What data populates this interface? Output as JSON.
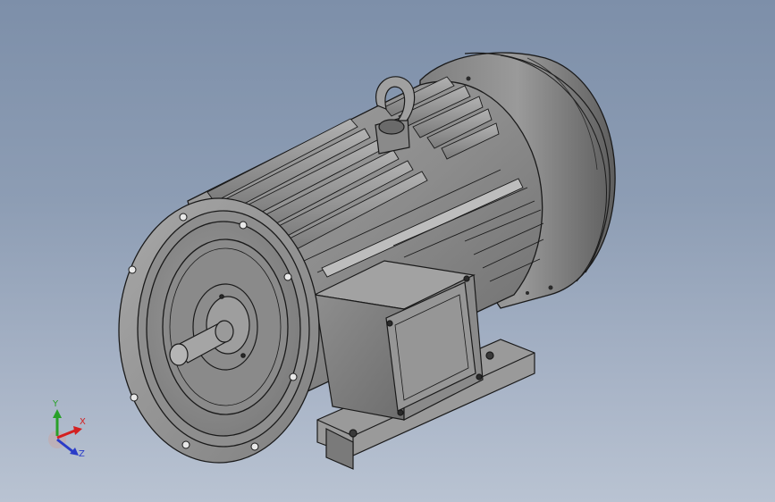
{
  "triad": {
    "x_label": "X",
    "y_label": "Y",
    "z_label": "Z",
    "x_color": "#d42020",
    "y_color": "#28a028",
    "z_color": "#2a3cc8"
  },
  "colors": {
    "background_top": "#7d8fa9",
    "background_bottom": "#b9c3d2",
    "body_metal": "#8a8a8a",
    "outline": "#1a1a1a"
  }
}
